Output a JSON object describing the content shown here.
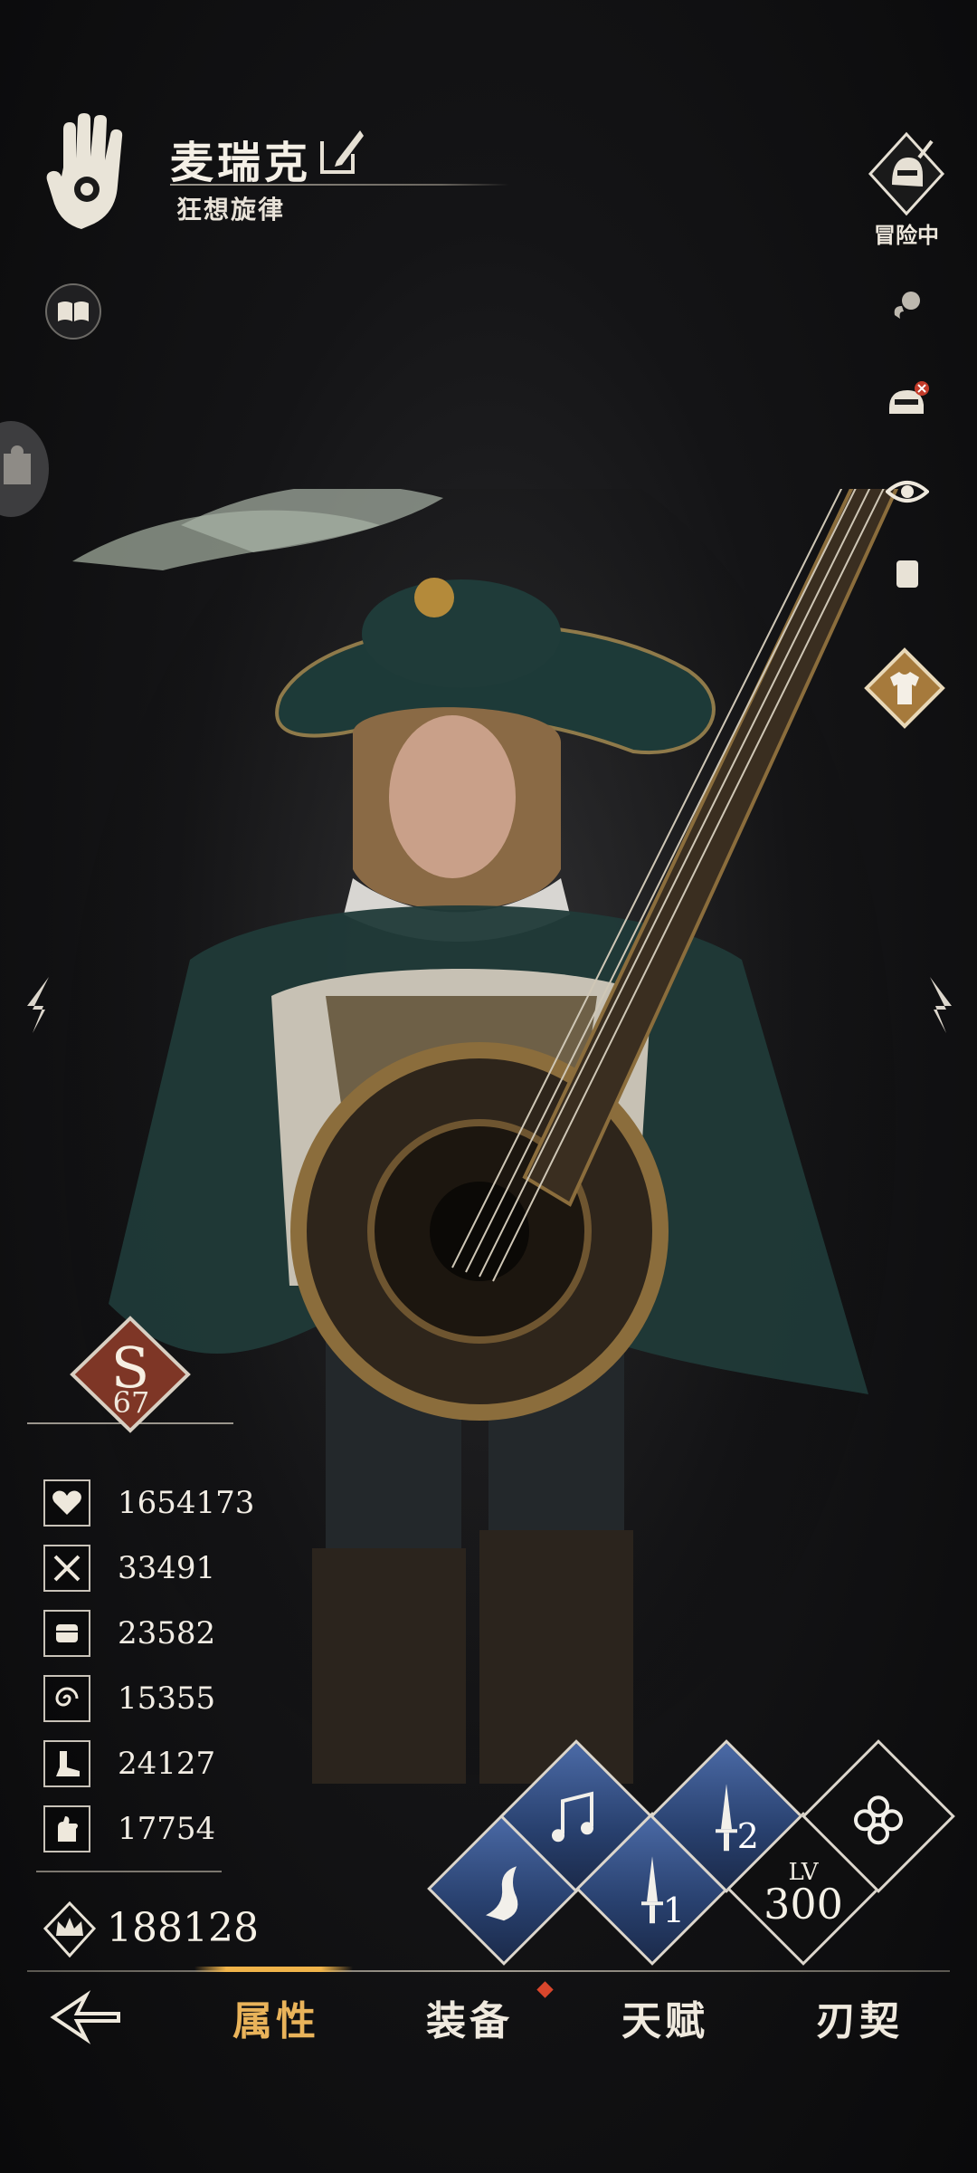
{
  "header": {
    "character_name": "麦瑞克",
    "character_title": "狂想旋律"
  },
  "status": {
    "adventure_label": "冒险中"
  },
  "rank": {
    "letter": "S",
    "level": "67"
  },
  "stats": [
    {
      "icon": "heart-icon",
      "value": "1654173"
    },
    {
      "icon": "crossed-swords-icon",
      "value": "33491"
    },
    {
      "icon": "fist-icon",
      "value": "23582"
    },
    {
      "icon": "spiral-icon",
      "value": "15355"
    },
    {
      "icon": "boot-icon",
      "value": "24127"
    },
    {
      "icon": "hand-sign-icon",
      "value": "17754"
    }
  ],
  "power": {
    "icon": "crown-icon",
    "value": "188128"
  },
  "skills": {
    "slot_1": "1",
    "slot_2": "2",
    "level_label": "LV",
    "level_value": "300"
  },
  "nav": {
    "items": [
      "属性",
      "装备",
      "天赋",
      "刃契"
    ],
    "active": "属性"
  },
  "colors": {
    "accent_gold": "#e9b35a",
    "skill_blue": "#3a5a94",
    "rank_red": "#8a3a2a",
    "notification_red": "#d9462c"
  }
}
